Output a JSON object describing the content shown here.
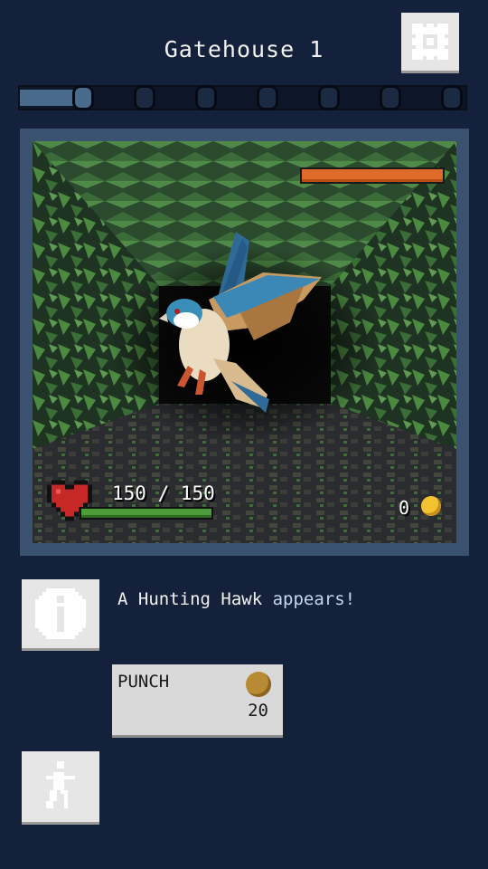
{
  "header": {
    "title": "Gatehouse 1",
    "settings_icon": "gear-icon"
  },
  "progress": {
    "total_nodes": 8,
    "current_node": 1,
    "fill_fraction": 0.15
  },
  "battle": {
    "enemy_name": "Hunting Hawk",
    "enemy_health_fraction": 1.0,
    "player": {
      "hp_text": "150 / 150",
      "hp_fraction": 1.0
    },
    "gold": {
      "amount": "0",
      "icon": "coin-icon"
    }
  },
  "log": {
    "info_icon": "info-icon",
    "message_prefix": "A Hunting Hawk",
    "message_suffix": " appears!"
  },
  "actions": [
    {
      "label": "PUNCH",
      "cost": "20",
      "icon": "brown-orb-icon"
    }
  ],
  "flee": {
    "icon": "running-figure-icon"
  },
  "colors": {
    "background": "#13213a",
    "enemy_health": "#e06a2a",
    "player_health": "#4c9c3a",
    "coin": "#f2c230",
    "button": "#e6e6e6"
  }
}
